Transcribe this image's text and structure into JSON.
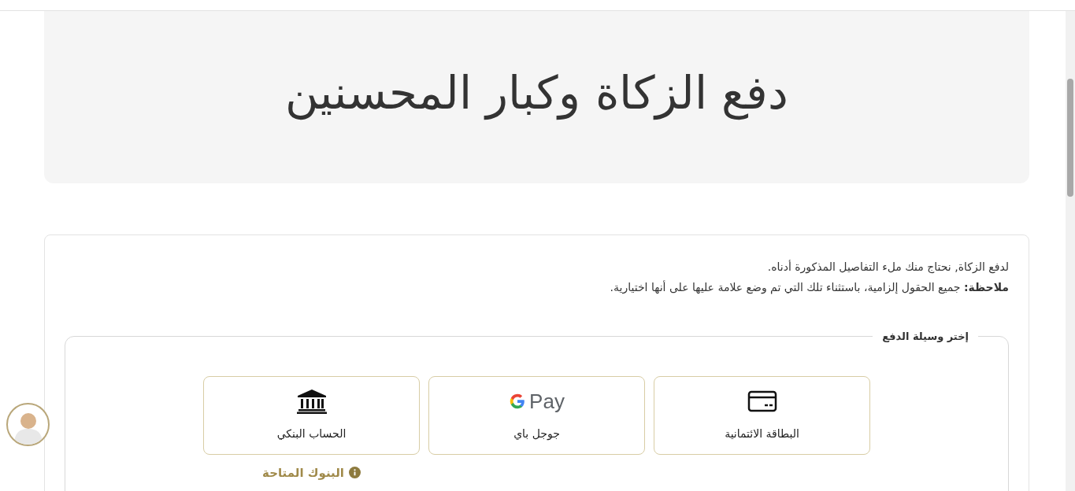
{
  "header": {
    "title": "دفع الزكاة وكبار المحسنين"
  },
  "intro": [
    "لدفع الزكاة, نحتاج منك ملء التفاصيل المذكورة أدناه.",
    "**ملاحظة:** جميع الحقول إلزامية، باستثناء تلك التي تم وضع علامة عليها على أنها اختيارية."
  ],
  "payment": {
    "legend": "إختر وسيلة الدفع",
    "methods": [
      {
        "kind": "card",
        "label": "البطاقة الائتمانية"
      },
      {
        "kind": "gpay",
        "label": "جوجل باي",
        "logo_text": "Pay"
      },
      {
        "kind": "bank",
        "label": "الحساب البنكي",
        "info_link": "البنوك المتاحة"
      }
    ]
  }
}
